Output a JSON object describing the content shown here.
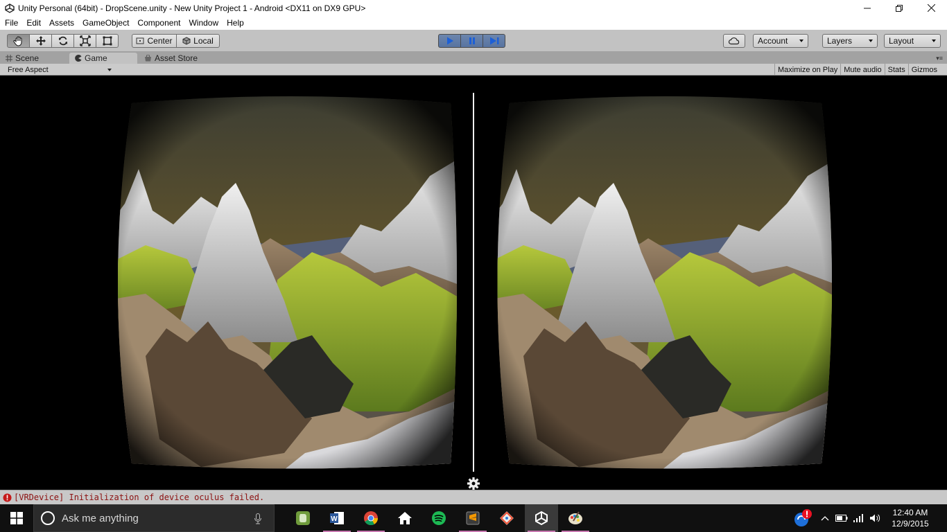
{
  "window": {
    "title": "Unity Personal (64bit) - DropScene.unity - New Unity Project 1 - Android <DX11 on DX9 GPU>",
    "icons": [
      "unity-icon",
      "minimize-icon",
      "maximize-icon",
      "close-icon"
    ]
  },
  "menu": [
    "File",
    "Edit",
    "Assets",
    "GameObject",
    "Component",
    "Window",
    "Help"
  ],
  "toolbar": {
    "transform_tools": [
      "hand-tool-icon",
      "move-tool-icon",
      "rotate-tool-icon",
      "scale-tool-icon",
      "rect-tool-icon"
    ],
    "pivot_label": "Center",
    "space_label": "Local",
    "play_controls": [
      "play-icon",
      "pause-icon",
      "step-icon"
    ],
    "account_label": "Account",
    "layers_label": "Layers",
    "layout_label": "Layout",
    "play_color": "#5d7aa8"
  },
  "tabs": {
    "scene": "Scene",
    "game": "Game",
    "asset_store": "Asset Store"
  },
  "game_toolbar": {
    "aspect": "Free Aspect",
    "maximize": "Maximize on Play",
    "mute": "Mute audio",
    "stats": "Stats",
    "gizmos": "Gizmos"
  },
  "status": {
    "message": "[VRDevice] Initialization of device oculus failed.",
    "color": "#8b1010"
  },
  "taskbar": {
    "search_placeholder": "Ask me anything",
    "apps": [
      "evernote-icon",
      "word-icon",
      "chrome-icon",
      "home-icon",
      "spotify-icon",
      "sublime-icon",
      "git-icon",
      "unity-icon",
      "paint-icon"
    ],
    "time": "12:40 AM",
    "date": "12/9/2015"
  }
}
